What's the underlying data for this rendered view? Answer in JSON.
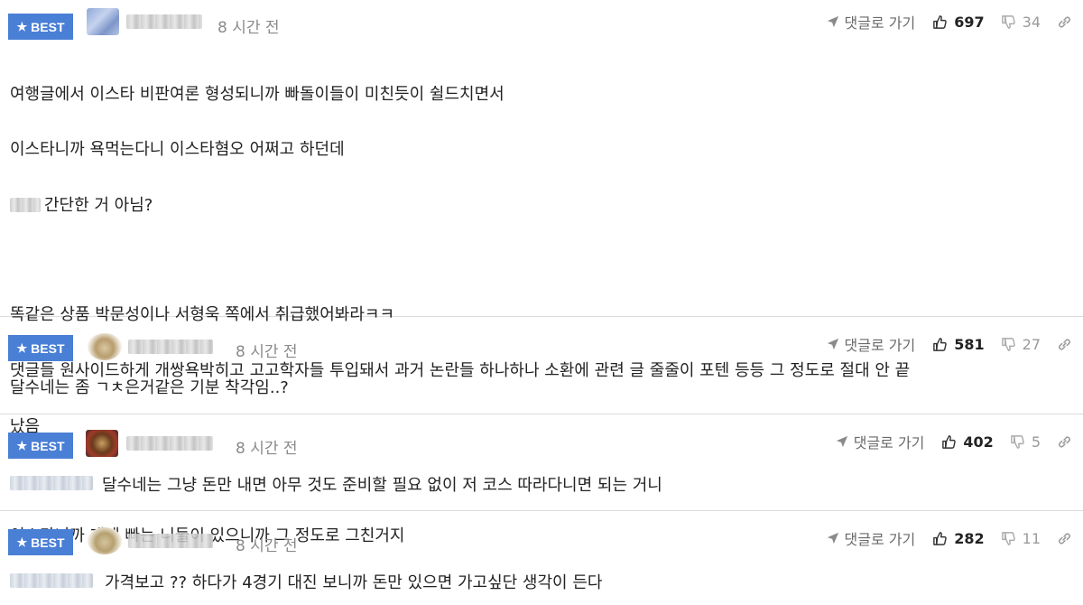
{
  "comments": [
    {
      "badge": "BEST",
      "time": "8 시간 전",
      "reply_label": "댓글로 가기",
      "likes": "697",
      "dislikes": "34",
      "body_lines": [
        "여행글에서 이스타 비판여론 형성되니까 빠돌이들이 미친듯이 쉴드치면서",
        "이스타니까 욕먹는다니 이스타혐오 어쩌고 하던데",
        "간단한 거 아님?",
        "똑같은 상품 박문성이나 서형욱 쪽에서 취급했어봐라ㅋㅋ",
        "댓글들 원사이드하게 개쌍욕박히고 고고학자들 투입돼서 과거 논란들 하나하나 소환에 관련 글 줄줄이 포텐 등등 그 정도로 절대 안 끝",
        "났음",
        "이스타니까 걔네 빠는 니들이 있으니까 그 정도로 그친거지"
      ]
    },
    {
      "badge": "BEST",
      "time": "8 시간 전",
      "reply_label": "댓글로 가기",
      "likes": "581",
      "dislikes": "27",
      "body": "달수네는 좀 ㄱㅊ은거같은 기분 착각임..?"
    },
    {
      "badge": "BEST",
      "time": "8 시간 전",
      "reply_label": "댓글로 가기",
      "likes": "402",
      "dislikes": "5",
      "body": "달수네는 그냥 돈만 내면 아무 것도 준비할 필요 없이 저 코스 따라다니면 되는 거니"
    },
    {
      "badge": "BEST",
      "time": "8 시간 전",
      "reply_label": "댓글로 가기",
      "likes": "282",
      "dislikes": "11",
      "body": "가격보고 ?? 하다가 4경기 대진 보니까 돈만 있으면 가고싶단 생각이 든다"
    }
  ],
  "colors": {
    "best_badge": "#4a7fd6",
    "text": "#222222",
    "muted": "#8a8a8a",
    "divider": "#dcdcdc"
  },
  "icons": [
    "star-icon",
    "send-icon",
    "thumbs-up-icon",
    "thumbs-down-icon",
    "link-icon"
  ]
}
